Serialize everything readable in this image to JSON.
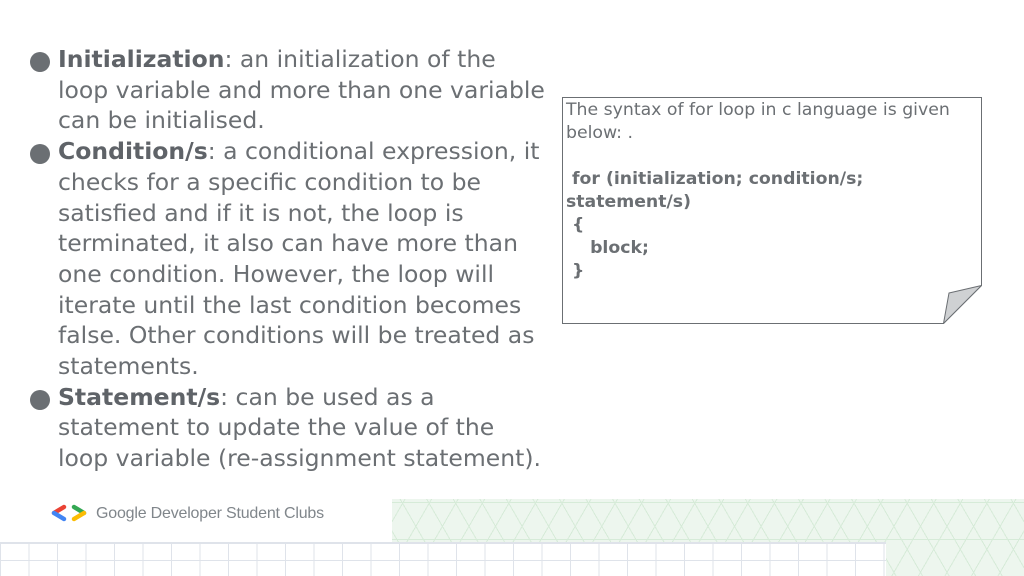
{
  "bullets": [
    {
      "term": "Initialization",
      "text": ": an initialization of the loop variable and more than one variable can be initialised."
    },
    {
      "term": "Condition/s",
      "text": ": a conditional expression, it checks for a specific condition to be satisfied and if it is not, the loop is terminated, it also can have more than one condition. However, the loop will iterate until the last condition becomes false. Other conditions will be treated as statements."
    },
    {
      "term": "Statement/s",
      "text": ": can be used as a statement to update the value of the loop variable (re-assignment statement)."
    }
  ],
  "note": {
    "intro": "The syntax of for loop in c language is given below: .",
    "code_lines": [
      " for (initialization; condition/s;",
      "statement/s)",
      " {",
      "    block;",
      " }"
    ]
  },
  "logo": {
    "text": "Google Developer Student Clubs"
  },
  "colors": {
    "text": "#6b6f73",
    "google_blue": "#4285F4",
    "google_red": "#EA4335",
    "google_yellow": "#FBBC04",
    "google_green": "#34A853",
    "grid_line": "#dfe3ea",
    "green_pattern": "#edf6ee"
  }
}
